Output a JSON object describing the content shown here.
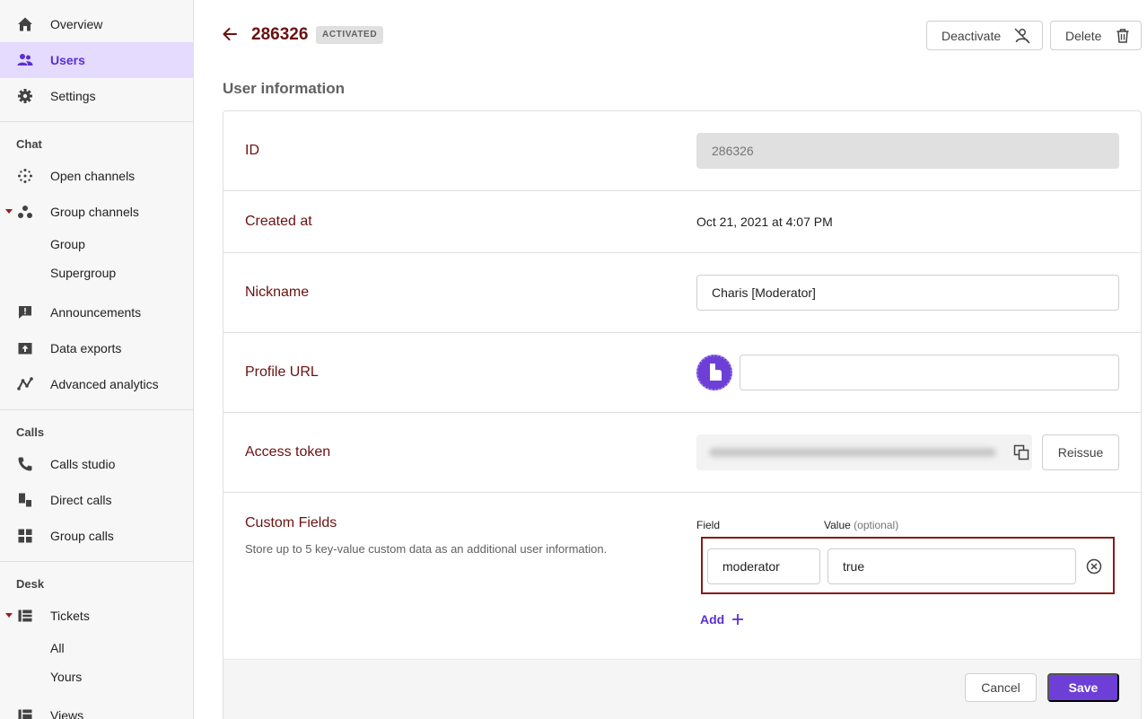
{
  "sidebar": {
    "top_items": [
      {
        "label": "Overview",
        "icon": "home-icon"
      },
      {
        "label": "Users",
        "icon": "users-icon",
        "active": true
      },
      {
        "label": "Settings",
        "icon": "gear-icon"
      }
    ],
    "chat": {
      "heading": "Chat",
      "items": [
        {
          "label": "Open channels",
          "icon": "open-channels-icon"
        },
        {
          "label": "Group channels",
          "icon": "group-channels-icon",
          "expanded": true
        }
      ],
      "sub_items": [
        "Group",
        "Supergroup"
      ],
      "items_after": [
        {
          "label": "Announcements",
          "icon": "announcement-icon"
        },
        {
          "label": "Data exports",
          "icon": "data-export-icon"
        },
        {
          "label": "Advanced analytics",
          "icon": "analytics-icon"
        }
      ]
    },
    "calls": {
      "heading": "Calls",
      "items": [
        {
          "label": "Calls studio",
          "icon": "phone-icon"
        },
        {
          "label": "Direct calls",
          "icon": "direct-calls-icon"
        },
        {
          "label": "Group calls",
          "icon": "group-calls-icon"
        }
      ]
    },
    "desk": {
      "heading": "Desk",
      "items": [
        {
          "label": "Tickets",
          "icon": "tickets-icon",
          "expanded": true
        }
      ],
      "sub_items": [
        "All",
        "Yours"
      ],
      "items_after": [
        {
          "label": "Views",
          "icon": "views-icon"
        }
      ]
    }
  },
  "header": {
    "user_id": "286326",
    "status_badge": "ACTIVATED",
    "deactivate_label": "Deactivate",
    "delete_label": "Delete"
  },
  "user_info": {
    "section_title": "User information",
    "id_label": "ID",
    "id_value": "286326",
    "created_label": "Created at",
    "created_value": "Oct 21, 2021 at 4:07 PM",
    "nickname_label": "Nickname",
    "nickname_value": "Charis [Moderator]",
    "profile_url_label": "Profile URL",
    "profile_url_value": "",
    "access_token_label": "Access token",
    "reissue_label": "Reissue"
  },
  "custom_fields": {
    "title": "Custom Fields",
    "description": "Store up to 5 key-value custom data as an additional user information.",
    "field_header": "Field",
    "value_header": "Value",
    "value_optional": "(optional)",
    "entries": [
      {
        "field": "moderator",
        "value": "true"
      }
    ],
    "add_label": "Add"
  },
  "footer": {
    "cancel_label": "Cancel",
    "save_label": "Save"
  },
  "colors": {
    "accent": "#6d3fd6",
    "label": "#6b1111",
    "highlight_border": "#8b1a1a",
    "active_nav_bg": "#e4dbff"
  }
}
